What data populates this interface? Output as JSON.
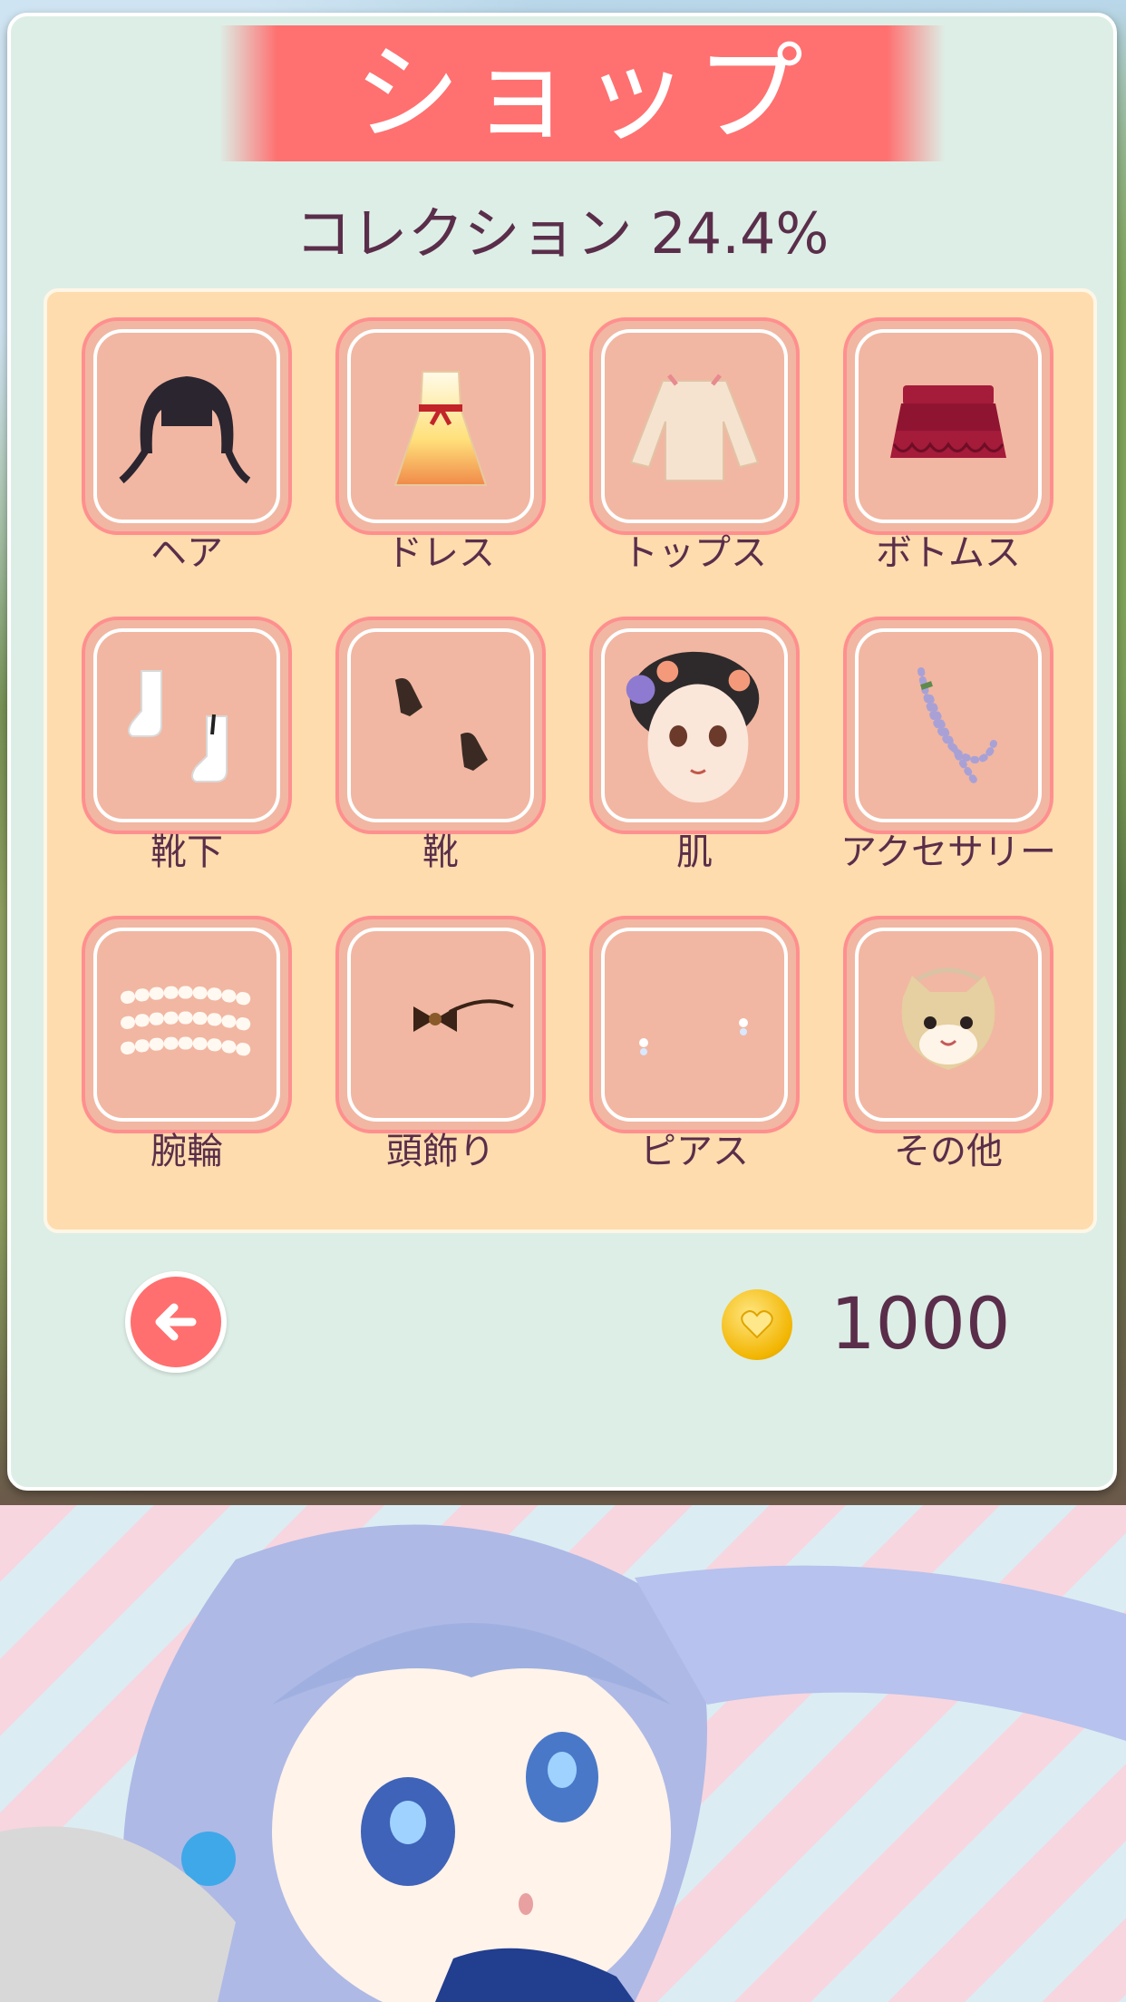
{
  "title": "ショップ",
  "collection": {
    "text": "コレクション 24.4%"
  },
  "categories": [
    {
      "label": "ヘア",
      "icon": "hair-icon"
    },
    {
      "label": "ドレス",
      "icon": "dress-icon"
    },
    {
      "label": "トップス",
      "icon": "tops-icon"
    },
    {
      "label": "ボトムス",
      "icon": "skirt-icon"
    },
    {
      "label": "靴下",
      "icon": "socks-icon"
    },
    {
      "label": "靴",
      "icon": "shoes-icon"
    },
    {
      "label": "肌",
      "icon": "skin-icon"
    },
    {
      "label": "アクセサリー",
      "icon": "necklace-icon"
    },
    {
      "label": "腕輪",
      "icon": "bracelet-icon"
    },
    {
      "label": "頭飾り",
      "icon": "hair-bow-icon"
    },
    {
      "label": "ピアス",
      "icon": "earring-icon"
    },
    {
      "label": "その他",
      "icon": "cat-bag-icon"
    }
  ],
  "footer": {
    "coins": "1000",
    "back_icon": "arrow-left-icon",
    "coin_icon": "heart-coin-icon"
  },
  "colors": {
    "accent": "#ff7070",
    "panel": "#ddeee6",
    "grid": "#fedcae",
    "tile": "#f1b7a2",
    "text": "#5a2e4a"
  }
}
